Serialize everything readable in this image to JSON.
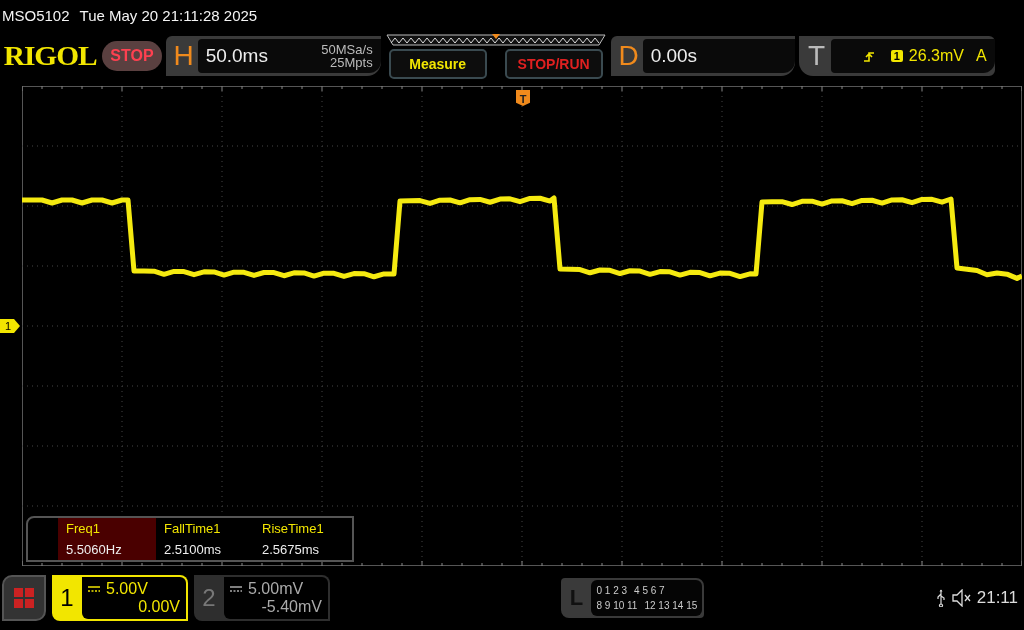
{
  "title_bar": {
    "model": "MSO5102",
    "datetime": "Tue May 20 21:11:28 2025"
  },
  "toolbar": {
    "logo": "RIGOL",
    "run_state": {
      "label": "STOP",
      "kind": "stop"
    },
    "horizontal": {
      "letter": "H",
      "timebase": "50.0ms",
      "sample_rate": "50MSa/s",
      "memory_depth": "25Mpts"
    },
    "buttons": [
      {
        "label": "Measure",
        "kind": "measure"
      },
      {
        "label": "STOP/RUN",
        "kind": "stoprun"
      }
    ],
    "delay": {
      "letter": "D",
      "value": "0.00s"
    },
    "trigger": {
      "letter": "T",
      "source": "1",
      "level": "26.3mV",
      "mode": "A"
    }
  },
  "screen": {
    "channel_marker": "1",
    "trigger_position_marker": "T"
  },
  "measurements": [
    {
      "name": "Freq1",
      "value": "5.5060Hz",
      "selected": true
    },
    {
      "name": "FallTime1",
      "value": "2.5100ms",
      "selected": false
    },
    {
      "name": "RiseTime1",
      "value": "2.5675ms",
      "selected": false
    }
  ],
  "channels": [
    {
      "number": "1",
      "scale": "5.00V",
      "offset": "0.00V",
      "active": true
    },
    {
      "number": "2",
      "scale": "5.00mV",
      "offset": "-5.40mV",
      "active": false
    }
  ],
  "logic": {
    "letter": "L",
    "rows": [
      [
        "0 1 2 3",
        "4 5 6 7"
      ],
      [
        "8 9 10 11",
        "12 13 14 15"
      ]
    ]
  },
  "status": {
    "time": "21:11"
  }
}
